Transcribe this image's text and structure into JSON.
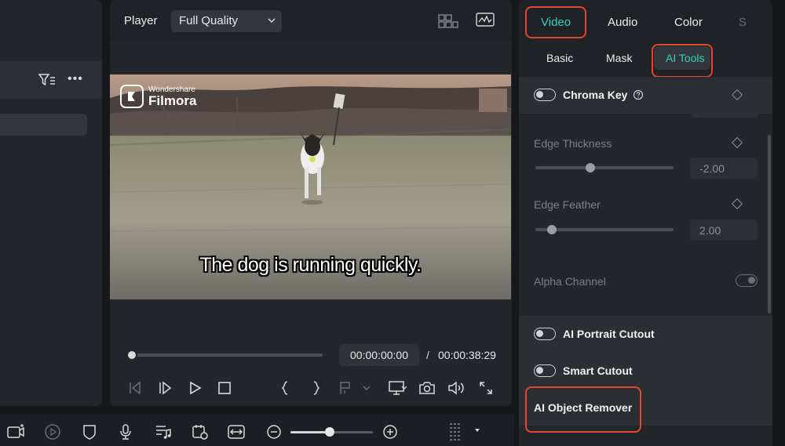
{
  "left_panel": {
    "filter_icon": "filter-icon",
    "more_icon": "more-icon",
    "more_label": "•••"
  },
  "player": {
    "label": "Player",
    "quality": "Full Quality",
    "current_time": "00:00:00:00",
    "separator": "/",
    "total_time": "00:00:38:29",
    "progress": 0,
    "caption": "The dog is running quickly.",
    "watermark_small": "Wondershare",
    "watermark_big": "Filmora"
  },
  "right_panel": {
    "tabs": [
      {
        "label": "Video",
        "active": true
      },
      {
        "label": "Audio",
        "active": false
      },
      {
        "label": "Color",
        "active": false
      },
      {
        "label": "S",
        "active": false
      }
    ],
    "subtabs": [
      {
        "label": "Basic",
        "active": false
      },
      {
        "label": "Mask",
        "active": false
      },
      {
        "label": "AI Tools",
        "active": true
      }
    ],
    "chroma_key": {
      "label": "Chroma Key",
      "enabled": false
    },
    "edge_thickness": {
      "label": "Edge Thickness",
      "value": "-2.00",
      "level": 0.4
    },
    "edge_feather": {
      "label": "Edge Feather",
      "value": "2.00",
      "level": 0.12
    },
    "alpha_channel": {
      "label": "Alpha Channel",
      "enabled": false
    },
    "ai_portrait_cutout": {
      "label": "AI Portrait Cutout",
      "enabled": false
    },
    "smart_cutout": {
      "label": "Smart Cutout",
      "enabled": false
    },
    "ai_object_remover": {
      "label": "AI Object Remover"
    }
  },
  "colors": {
    "accent": "#2fd4bc",
    "highlight": "#e4462e",
    "panel": "#23262b",
    "background": "#16181c"
  },
  "timeline_toolbar": {
    "zoom_level": 0.48
  }
}
